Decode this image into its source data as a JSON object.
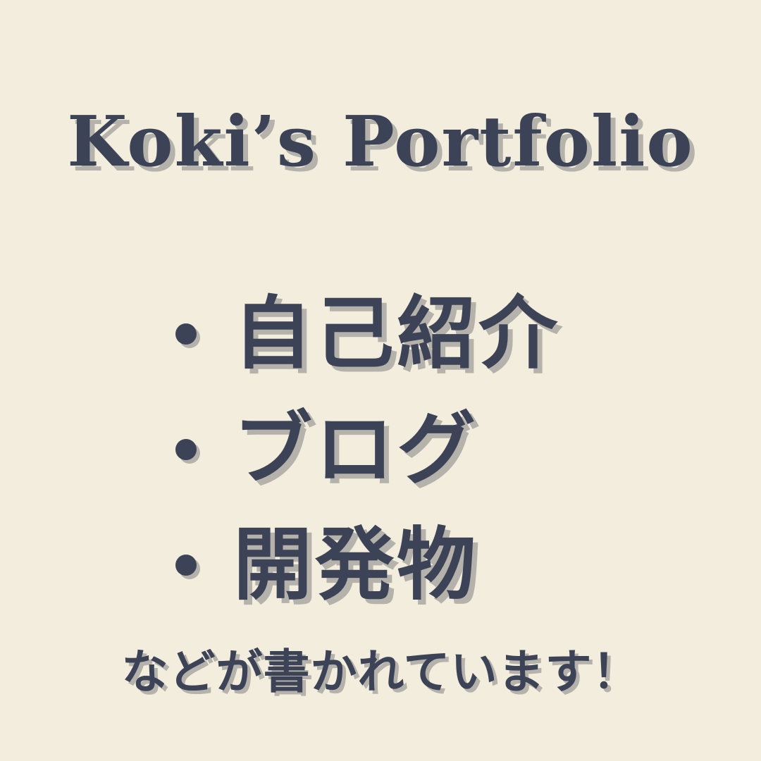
{
  "title": "Koki’s Portfolio",
  "items": [
    {
      "label": "自己紹介"
    },
    {
      "label": "ブログ"
    },
    {
      "label": "開発物"
    }
  ],
  "footer": "などが書かれています！",
  "colors": {
    "background": "#f2eddc",
    "text": "#3d4356",
    "shadow": "#b5b2ac"
  }
}
